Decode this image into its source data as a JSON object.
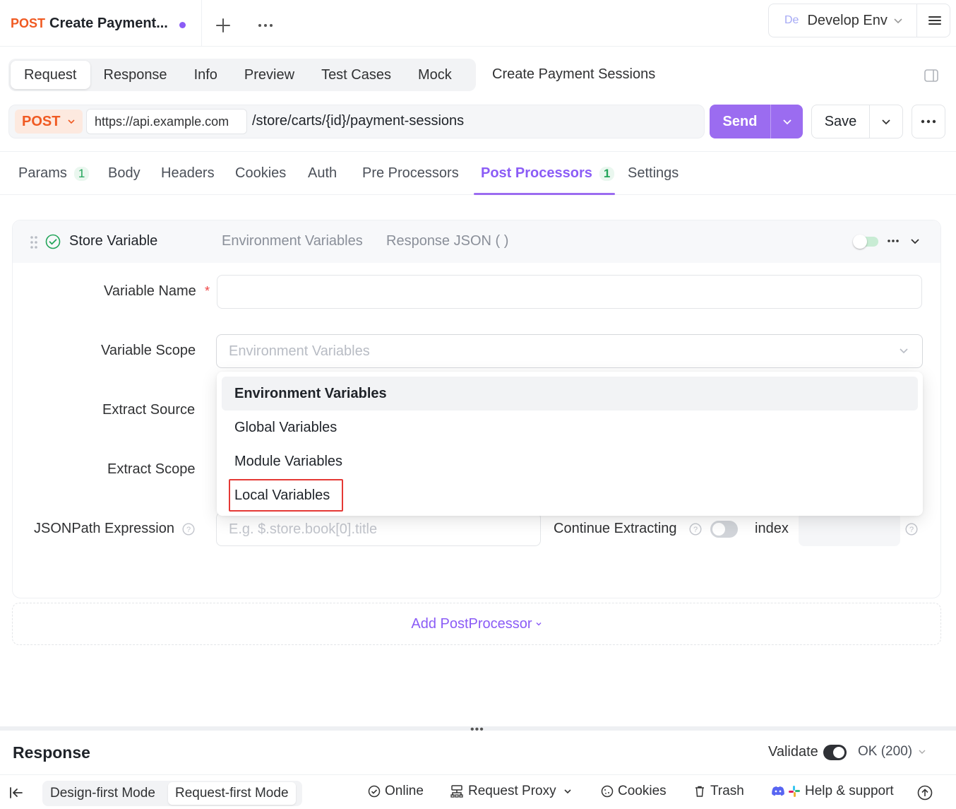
{
  "top_tab": {
    "method": "POST",
    "title": "Create Payment..."
  },
  "environment": {
    "badge": "De",
    "name": "Develop Env"
  },
  "sub_tabs": [
    "Request",
    "Response",
    "Info",
    "Preview",
    "Test Cases",
    "Mock"
  ],
  "endpoint_name": "Create Payment Sessions",
  "url_bar": {
    "method": "POST",
    "base_url": "https://api.example.com",
    "path": "/store/carts/{id}/payment-sessions"
  },
  "actions": {
    "send": "Send",
    "save": "Save"
  },
  "request_tabs": {
    "params": "Params",
    "params_count": "1",
    "body": "Body",
    "headers": "Headers",
    "cookies": "Cookies",
    "auth": "Auth",
    "pre": "Pre Processors",
    "post": "Post Processors",
    "post_count": "1",
    "settings": "Settings"
  },
  "processor": {
    "title": "Store Variable",
    "scope_summary": "Environment Variables",
    "source_summary": "Response JSON ( )",
    "enabled": true
  },
  "form": {
    "variable_name_label": "Variable Name",
    "required_mark": "*",
    "variable_scope_label": "Variable Scope",
    "variable_scope_placeholder": "Environment Variables",
    "extract_source_label": "Extract Source",
    "extract_scope_label": "Extract Scope",
    "jsonpath_label": "JSONPath Expression",
    "jsonpath_placeholder": "E.g. $.store.book[0].title",
    "continue_label": "Continue Extracting",
    "index_label": "index"
  },
  "scope_options": [
    "Environment Variables",
    "Global Variables",
    "Module Variables",
    "Local Variables"
  ],
  "add_postprocessor": "Add PostProcessor",
  "response": {
    "title": "Response",
    "validate_label": "Validate",
    "status": "OK (200)"
  },
  "footer": {
    "design_mode": "Design-first Mode",
    "request_mode": "Request-first Mode",
    "online": "Online",
    "proxy": "Request Proxy",
    "cookies": "Cookies",
    "trash": "Trash",
    "help": "Help & support"
  },
  "colors": {
    "accent": "#9b6cf0",
    "method_post": "#f05a22",
    "count_green": "#23a55a",
    "highlight": "#e53935"
  }
}
